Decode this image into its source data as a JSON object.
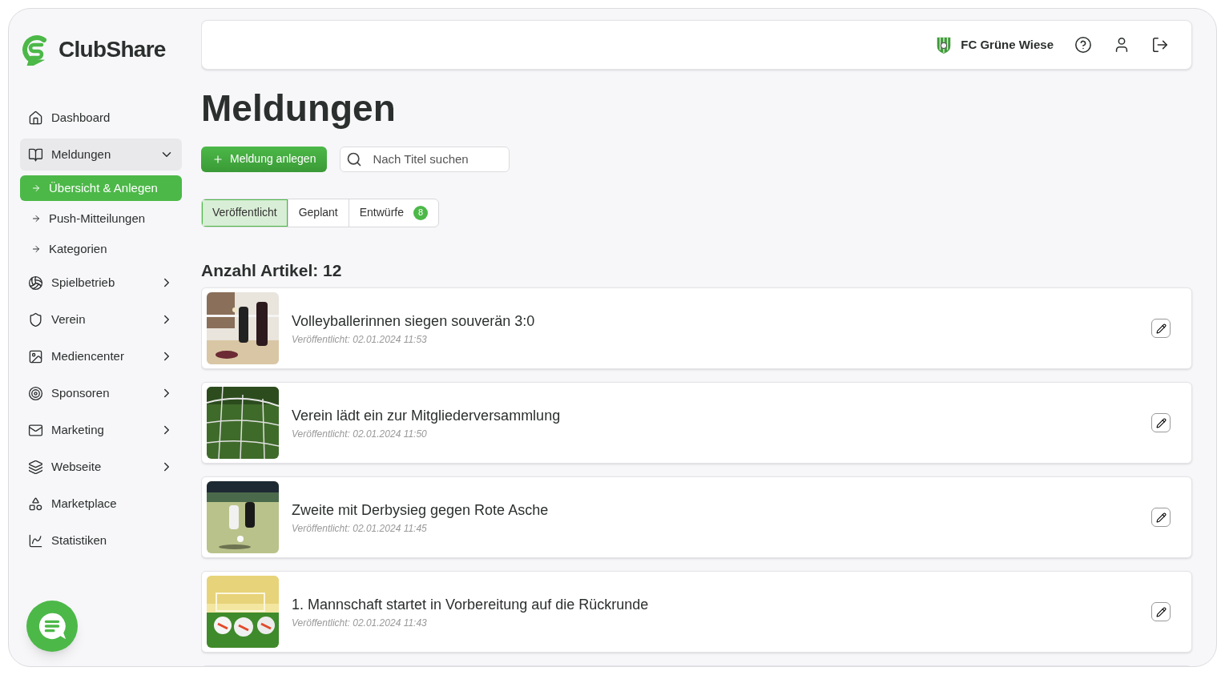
{
  "brand": {
    "name": "ClubShare"
  },
  "sidebar": {
    "items": [
      {
        "label": "Dashboard"
      },
      {
        "label": "Meldungen",
        "expanded": true,
        "children": [
          {
            "label": "Übersicht & Anlegen",
            "selected": true
          },
          {
            "label": "Push-Mitteilungen",
            "selected": false
          },
          {
            "label": "Kategorien",
            "selected": false
          }
        ]
      },
      {
        "label": "Spielbetrieb",
        "expanded": false
      },
      {
        "label": "Verein",
        "expanded": false
      },
      {
        "label": "Mediencenter",
        "expanded": false
      },
      {
        "label": "Sponsoren",
        "expanded": false
      },
      {
        "label": "Marketing",
        "expanded": false
      },
      {
        "label": "Webseite",
        "expanded": false
      },
      {
        "label": "Marketplace"
      },
      {
        "label": "Statistiken"
      }
    ]
  },
  "header": {
    "club": "FC Grüne Wiese"
  },
  "page": {
    "title": "Meldungen",
    "create_button": "Meldung anlegen",
    "search": {
      "placeholder": "Nach Titel suchen"
    }
  },
  "tabs": [
    {
      "label": "Veröffentlicht",
      "selected": true
    },
    {
      "label": "Geplant",
      "selected": false
    },
    {
      "label": "Entwürfe",
      "selected": false,
      "badge": "8"
    }
  ],
  "count_label": "Anzahl Artikel: 12",
  "articles": [
    {
      "title": "Volleyballerinnen siegen souverän 3:0",
      "date": "Veröffentlicht: 02.01.2024 11:53"
    },
    {
      "title": "Verein lädt ein zur Mitgliederversammlung",
      "date": "Veröffentlicht: 02.01.2024 11:50"
    },
    {
      "title": "Zweite mit Derbysieg gegen Rote Asche",
      "date": "Veröffentlicht: 02.01.2024 11:45"
    },
    {
      "title": "1. Mannschaft startet in Vorbereitung auf die Rückrunde",
      "date": "Veröffentlicht: 02.01.2024 11:43"
    }
  ]
}
